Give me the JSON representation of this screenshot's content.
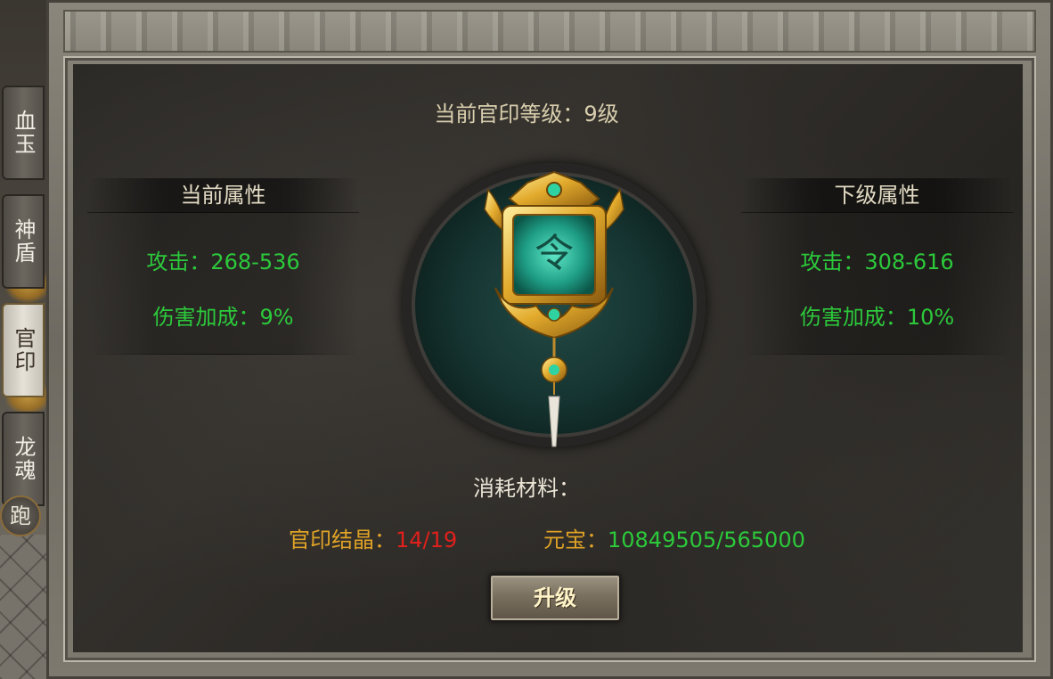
{
  "tabs": [
    {
      "label": "血玉",
      "active": false
    },
    {
      "label": "神盾",
      "active": false
    },
    {
      "label": "官印",
      "active": true
    },
    {
      "label": "龙魂",
      "active": false
    }
  ],
  "run_button_label": "跑",
  "level_title": "当前官印等级：9级",
  "current": {
    "header": "当前属性",
    "attack": "攻击：268-536",
    "damage_bonus": "伤害加成：9%"
  },
  "next": {
    "header": "下级属性",
    "attack": "攻击：308-616",
    "damage_bonus": "伤害加成：10%"
  },
  "seal": {
    "glyph": "令",
    "icon": "official-seal-icon"
  },
  "cost": {
    "label": "消耗材料：",
    "crystal_label": "官印结晶：",
    "crystal_value": "14/19",
    "ingot_label": "元宝：",
    "ingot_value": "10849505/565000"
  },
  "upgrade_button": "升级",
  "colors": {
    "attribute_green": "#2cc93b",
    "cost_gold": "#e0a326",
    "insufficient_red": "#e0201b",
    "title_beige": "#d9cfae"
  }
}
